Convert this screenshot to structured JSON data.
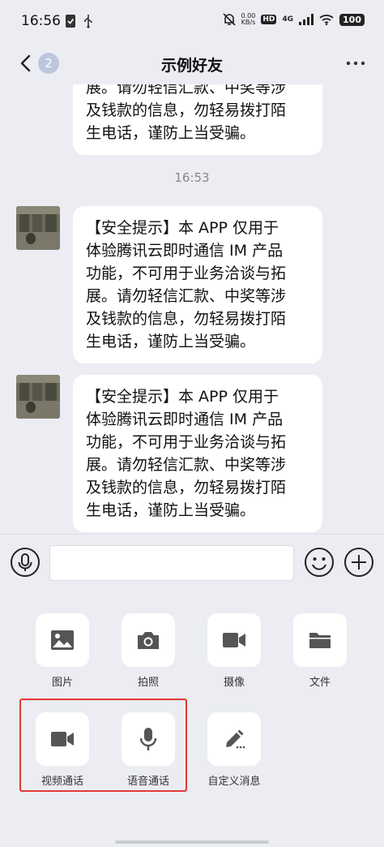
{
  "status_bar": {
    "time": "16:56",
    "speed_value": "0.00",
    "speed_unit": "KB/s",
    "hd_label": "HD",
    "network_label": "4G",
    "battery_level": "100"
  },
  "nav": {
    "unread_count": "2",
    "title": "示例好友"
  },
  "chat": {
    "partial_message_lines": [
      "展。请勿轻信汇款、中奖等涉",
      "及钱款的信息，勿轻易拨打陌",
      "生电话，谨防上当受骗。"
    ],
    "timestamp": "16:53",
    "messages": [
      {
        "lines": [
          "【安全提示】本 APP 仅用于",
          "体验腾讯云即时通信 IM 产品",
          "功能，不可用于业务洽谈与拓",
          "展。请勿轻信汇款、中奖等涉",
          "及钱款的信息，勿轻易拨打陌",
          "生电话，谨防上当受骗。"
        ]
      },
      {
        "lines": [
          "【安全提示】本 APP 仅用于",
          "体验腾讯云即时通信 IM 产品",
          "功能，不可用于业务洽谈与拓",
          "展。请勿轻信汇款、中奖等涉",
          "及钱款的信息，勿轻易拨打陌",
          "生电话，谨防上当受骗。"
        ]
      }
    ]
  },
  "input": {
    "value": "",
    "placeholder": ""
  },
  "tools": {
    "image_label": "图片",
    "photo_label": "拍照",
    "video_record_label": "摄像",
    "file_label": "文件",
    "video_call_label": "视频通话",
    "voice_call_label": "语音通话",
    "custom_message_label": "自定义消息"
  },
  "colors": {
    "background": "#ebedf3",
    "bubble": "#ffffff",
    "highlight": "#e23a36",
    "badge": "#bcc7dd"
  }
}
